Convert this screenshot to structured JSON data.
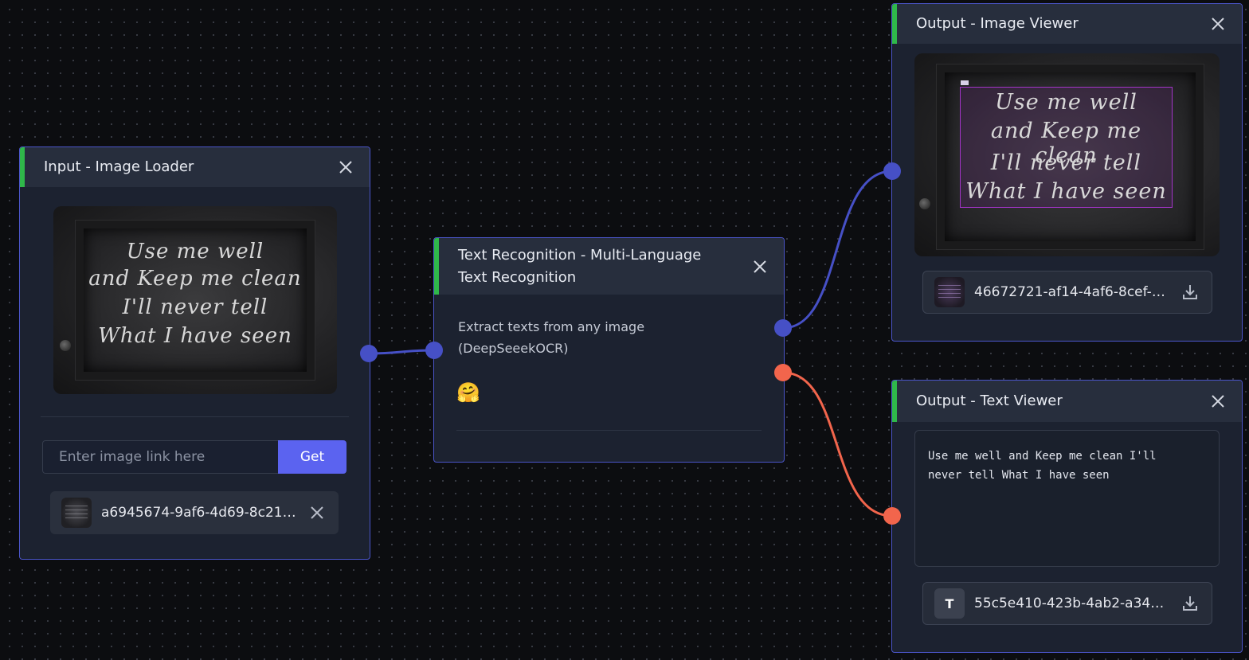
{
  "nodes": {
    "image_loader": {
      "title": "Input - Image Loader",
      "board_lines": [
        "Use me well",
        "and Keep me clean",
        "I'll never tell",
        "What I have seen"
      ],
      "url_placeholder": "Enter image link here",
      "get_label": "Get",
      "file_name": "a6945674-9af6-4d69-8c21-..."
    },
    "text_recognition": {
      "title_line1": "Text Recognition - Multi-Language",
      "title_line2": "Text Recognition",
      "description_line1": "Extract texts from any image",
      "description_line2": "(DeepSeeekOCR)",
      "provider_icon": "🤗"
    },
    "image_viewer": {
      "title": "Output - Image Viewer",
      "file_name": "46672721-af14-4af6-8cef-2..."
    },
    "text_viewer": {
      "title": "Output - Text Viewer",
      "text_line1": "Use me well and Keep me clean I'll",
      "text_line2": "never tell What I have seen",
      "file_badge": "T",
      "file_name": "55c5e410-423b-4ab2-a343-..."
    }
  },
  "colors": {
    "node_border": "#4b55c9",
    "header_accent": "#2fb84a",
    "wire_image": "#4650c6",
    "wire_text": "#f2654c",
    "button": "#5b63f0",
    "ocr_box": "#a334c8"
  },
  "icons": {
    "close": "close-icon",
    "download": "download-icon",
    "provider": "hugging-face-icon"
  }
}
